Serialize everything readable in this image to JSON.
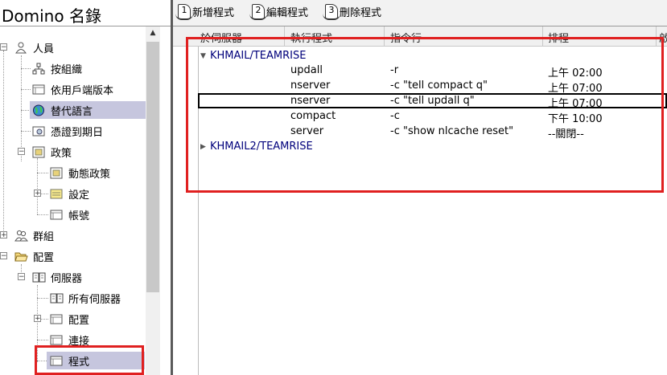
{
  "app": {
    "title": "Domino 名錄"
  },
  "toolbar": {
    "buttons": [
      {
        "num": "1",
        "label": "新增程式"
      },
      {
        "num": "2",
        "label": "編輯程式"
      },
      {
        "num": "3",
        "label": "刪除程式"
      }
    ]
  },
  "tree": {
    "people": "人員",
    "by_org": "按組織",
    "by_client_version": "依用戶端版本",
    "alt_language": "替代語言",
    "cert_expiry": "憑證到期日",
    "policies": "政策",
    "dynamic_policies": "動態政策",
    "settings": "設定",
    "accounts": "帳號",
    "groups": "群組",
    "configuration": "配置",
    "servers": "伺服器",
    "all_servers": "所有伺服器",
    "config": "配置",
    "connections": "連接",
    "programs": "程式"
  },
  "grid": {
    "headers": {
      "server": "於伺服器",
      "program": "執行程式",
      "cmdline": "指令行",
      "schedule": "排程",
      "extra": "啟"
    },
    "groups": [
      {
        "name": "KHMAIL/TEAMRISE",
        "expanded": true
      },
      {
        "name": "KHMAIL2/TEAMRISE",
        "expanded": false
      }
    ],
    "rows": [
      {
        "program": "updall",
        "cmdline": "-r",
        "schedule": "上午 02:00"
      },
      {
        "program": "nserver",
        "cmdline": "-c \"tell compact q\"",
        "schedule": "上午 07:00"
      },
      {
        "program": "nserver",
        "cmdline": "-c \"tell updall q\"",
        "schedule": "上午 07:00"
      },
      {
        "program": "compact",
        "cmdline": "-c",
        "schedule": "下午 10:00"
      },
      {
        "program": "server",
        "cmdline": "-c \"show nlcache reset\"",
        "schedule": "--關閉--"
      }
    ]
  }
}
